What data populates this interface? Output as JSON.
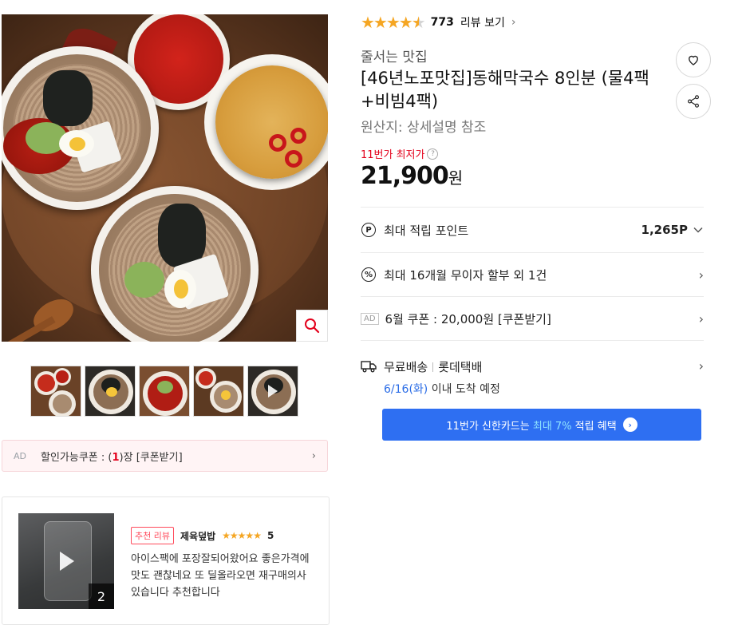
{
  "gallery": {
    "zoom_icon": "magnifier-icon",
    "thumbnails": [
      {
        "name": "thumb-1",
        "kind": "image"
      },
      {
        "name": "thumb-2",
        "kind": "image"
      },
      {
        "name": "thumb-3",
        "kind": "image"
      },
      {
        "name": "thumb-4",
        "kind": "image"
      },
      {
        "name": "thumb-5",
        "kind": "video"
      }
    ]
  },
  "ad_coupon": {
    "tag": "AD",
    "prefix": "할인가능쿠폰 : (",
    "count": "1",
    "suffix": ")장 [쿠폰받기]"
  },
  "review": {
    "badge": "추천 리뷰",
    "author": "제육덮밥",
    "stars": "★★★★★",
    "score": "5",
    "text": "아이스팩에 포장잘되어왔어요 좋은가격에 맛도 괜찮네요 또 딜올라오면 재구매의사 있습니다 추천합니다",
    "media_count": "2"
  },
  "product": {
    "rating_stars": "★★★★",
    "rating_half": "★",
    "rating_value": 4.5,
    "review_count": "773",
    "review_link": "리뷰 보기",
    "store": "줄서는 맛집",
    "title": "[46년노포맛집]동해막국수 8인분 (물4팩+비빔4팩)",
    "origin": "원산지:  상세설명 참조",
    "lowest_label": "11번가 최저가",
    "price": "21,900",
    "price_unit": "원"
  },
  "benefits": {
    "point_label": "최대 적립 포인트",
    "point_value": "1,265P",
    "install_label": "최대 16개월 무이자 할부 외 1건",
    "coupon_ad": "AD",
    "coupon_label": "6월 쿠폰 : 20,000원 [쿠폰받기]",
    "ship_label": "무료배송",
    "ship_carrier": "롯데택배",
    "ship_date": "6/16(화)",
    "ship_suffix": " 이내 도착 예정"
  },
  "cta": {
    "prefix": "11번가 신한카드는 ",
    "highlight": "최대 7%",
    "suffix": " 적립 혜택"
  },
  "colors": {
    "accent_blue": "#2e6ff2",
    "price_red": "#e3001b",
    "star": "#f5a623"
  }
}
